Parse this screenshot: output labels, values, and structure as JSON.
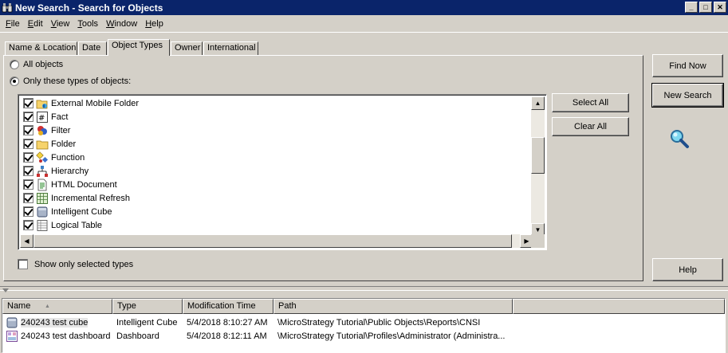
{
  "window": {
    "title": "New Search - Search for Objects",
    "minimize_glyph": "_",
    "maximize_glyph": "□",
    "close_glyph": "✕"
  },
  "menu": [
    {
      "label": "File",
      "u": "F",
      "rest": "ile"
    },
    {
      "label": "Edit",
      "u": "E",
      "rest": "dit"
    },
    {
      "label": "View",
      "u": "V",
      "rest": "iew"
    },
    {
      "label": "Tools",
      "u": "T",
      "rest": "ools"
    },
    {
      "label": "Window",
      "u": "W",
      "rest": "indow"
    },
    {
      "label": "Help",
      "u": "H",
      "rest": "elp"
    }
  ],
  "tabs": [
    "Name & Location",
    "Date",
    "Object Types",
    "Owner",
    "International"
  ],
  "active_tab": "Object Types",
  "options": {
    "all_objects": "All objects",
    "only_these": "Only these types of objects:",
    "selected": "only_these"
  },
  "object_types": [
    {
      "label": "External Mobile Folder",
      "icon": "external-mobile-folder-icon",
      "checked": true
    },
    {
      "label": "Fact",
      "icon": "fact-icon",
      "checked": true
    },
    {
      "label": "Filter",
      "icon": "filter-icon",
      "checked": true
    },
    {
      "label": "Folder",
      "icon": "folder-icon",
      "checked": true
    },
    {
      "label": "Function",
      "icon": "function-icon",
      "checked": true
    },
    {
      "label": "Hierarchy",
      "icon": "hierarchy-icon",
      "checked": true
    },
    {
      "label": "HTML Document",
      "icon": "html-document-icon",
      "checked": true
    },
    {
      "label": "Incremental Refresh",
      "icon": "incremental-refresh-icon",
      "checked": true
    },
    {
      "label": "Intelligent Cube",
      "icon": "intelligent-cube-icon",
      "checked": true
    },
    {
      "label": "Logical Table",
      "icon": "logical-table-icon",
      "checked": true
    }
  ],
  "list_scroll": {
    "vertical_position": 0.35
  },
  "buttons": {
    "select_all": "Select All",
    "clear_all": "Clear All",
    "find_now": "Find Now",
    "new_search": "New Search",
    "help": "Help"
  },
  "show_only_selected": {
    "label": "Show only selected types",
    "checked": false
  },
  "results": {
    "columns": [
      "Name",
      "Type",
      "Modification Time",
      "Path"
    ],
    "sort_indicator": "▲",
    "rows": [
      {
        "name": "240243 test cube",
        "type": "Intelligent Cube",
        "modified": "5/4/2018 8:10:27 AM",
        "path": "\\MicroStrategy Tutorial\\Public Objects\\Reports\\CNSI",
        "icon": "intelligent-cube-icon"
      },
      {
        "name": "240243 test dashboard",
        "type": "Dashboard",
        "modified": "5/4/2018 8:12:11 AM",
        "path": "\\MicroStrategy Tutorial\\Profiles\\Administrator (Administra...",
        "icon": "dashboard-icon"
      }
    ]
  }
}
